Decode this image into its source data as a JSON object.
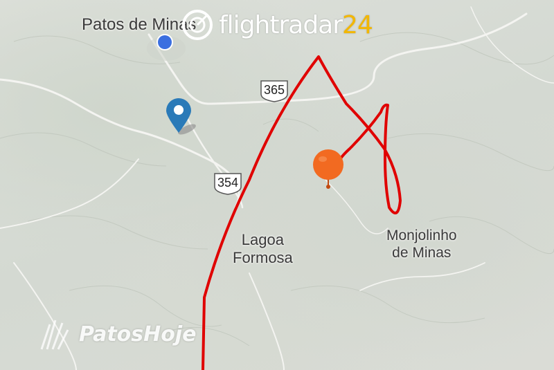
{
  "map": {
    "places": {
      "patos_de_minas": "Patos de Minas",
      "lagoa_formosa_line1": "Lagoa",
      "lagoa_formosa_line2": "Formosa",
      "monjolinho_line1": "Monjolinho",
      "monjolinho_line2": "de Minas"
    },
    "roads": {
      "highway_365": "365",
      "highway_354": "354"
    },
    "markers": {
      "location_pin_icon": "map-pin-icon",
      "current_location_icon": "blue-dot-icon",
      "balloon_icon": "orange-balloon-icon"
    },
    "colors": {
      "flight_track": "#e00000",
      "balloon": "#f26a21",
      "pin": "#2a7ab8",
      "dot": "#3b6fe0",
      "logo_accent": "#f2b705"
    }
  },
  "overlays": {
    "logo": {
      "brand": "flightradar",
      "number": "24"
    },
    "watermark": "PatosHoje"
  }
}
